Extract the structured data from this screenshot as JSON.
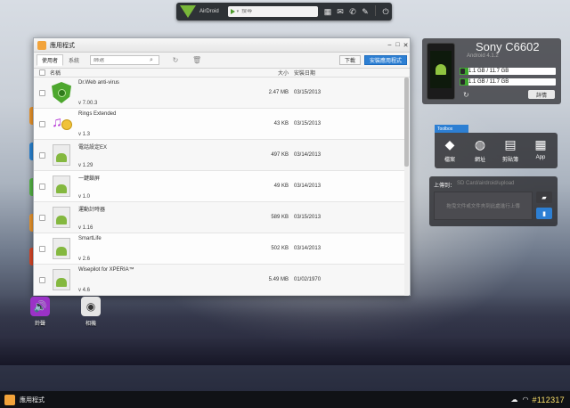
{
  "topbar": {
    "brand": "AirDroid",
    "search_placeholder": "搜尋"
  },
  "window": {
    "title": "應用程式",
    "tabs": [
      {
        "label": "使用者"
      },
      {
        "label": "系統"
      }
    ],
    "filter_placeholder": "篩選",
    "download_label": "下載",
    "install_label": "安裝應用程式",
    "columns": {
      "name": "名稱",
      "size": "大小",
      "date": "安裝日期"
    },
    "apps": [
      {
        "name": "Dr.Web anti-virus",
        "version": "v 7.00.3",
        "size": "2.47 MB",
        "date": "03/15/2013",
        "icon": "shield-icon"
      },
      {
        "name": "Rings Extended",
        "version": "v 1.3",
        "size": "43 KB",
        "date": "03/15/2013",
        "icon": "music-bell-icon"
      },
      {
        "name": "電話設定EX",
        "version": "v 1.29",
        "size": "497 KB",
        "date": "03/14/2013",
        "icon": "android-doc-icon"
      },
      {
        "name": "一鍵鎖屏",
        "version": "v 1.0",
        "size": "49 KB",
        "date": "03/14/2013",
        "icon": "android-doc-icon"
      },
      {
        "name": "運動計時器",
        "version": "v 1.16",
        "size": "589 KB",
        "date": "03/15/2013",
        "icon": "android-doc-icon"
      },
      {
        "name": "SmartLife",
        "version": "v 2.6",
        "size": "502 KB",
        "date": "03/14/2013",
        "icon": "android-doc-icon"
      },
      {
        "name": "Wisepilot for XPERIA™",
        "version": "v 4.6",
        "size": "5.49 MB",
        "date": "01/02/1970",
        "icon": "android-doc-icon"
      }
    ]
  },
  "desktop": {
    "ringtone_label": "鈴聲",
    "camera_label": "相機"
  },
  "device": {
    "name": "Sony C6602",
    "android": "Android 4.1.2",
    "storage1": "1.1 GB / 11.7 GB",
    "storage2": "1.1 GB / 11.7 GB",
    "storage1_fraction": 0.09,
    "storage2_fraction": 0.09,
    "details_label": "詳情"
  },
  "toolbox": {
    "tab": "Toolbox",
    "tools": [
      {
        "label": "檔案",
        "icon": "android-icon"
      },
      {
        "label": "網址",
        "icon": "globe-icon"
      },
      {
        "label": "剪貼簿",
        "icon": "clipboard-icon"
      },
      {
        "label": "App",
        "icon": "grid-icon"
      }
    ]
  },
  "upload": {
    "label": "上傳到：",
    "path": "SD Card/airdroid/upload",
    "drop_hint": "拖曳文件或文件夾到此處進行上傳"
  },
  "taskbar": {
    "app_label": "應用程式",
    "time": "#112317"
  },
  "colors": {
    "accent": "#2d7fd3",
    "android_green": "#84b83f",
    "storage_green": "#3fa92f"
  }
}
